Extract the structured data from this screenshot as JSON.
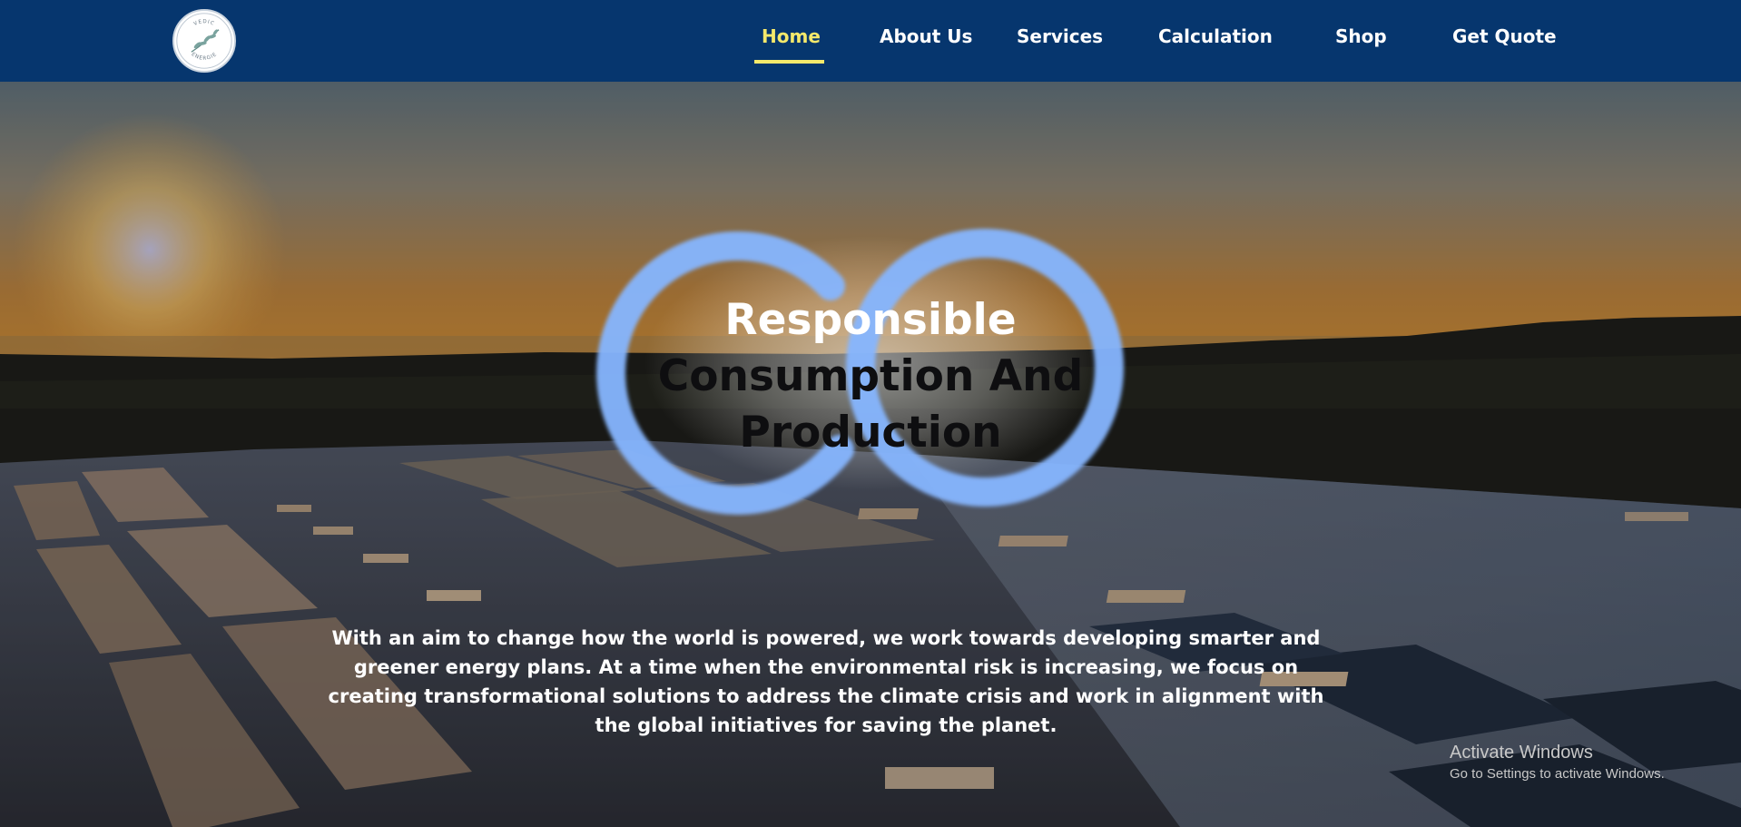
{
  "brand": {
    "logo_text_top": "VEDIC",
    "logo_text_bottom": "ENERGIE"
  },
  "nav": {
    "items": [
      {
        "label": "Home",
        "active": true
      },
      {
        "label": "About Us"
      },
      {
        "label": "Services"
      },
      {
        "label": "Calculation"
      },
      {
        "label": "Shop"
      },
      {
        "label": "Get Quote"
      }
    ]
  },
  "hero": {
    "title_line1": "Responsible",
    "title_line2": "Consumption And",
    "title_line3": "Production",
    "description": "With an aim to change how the world is powered, we work towards developing smarter and greener energy plans. At a time when the environmental risk is increasing, we focus on creating transformational solutions to address the climate crisis and work in alignment with the global initiatives for saving the planet."
  },
  "watermark": {
    "line1": "Activate Windows",
    "line2": "Go to Settings to activate Windows."
  },
  "colors": {
    "navbar": "#06366e",
    "active_nav": "#f5e96b",
    "infinity_blue": "#8ab8ff"
  }
}
